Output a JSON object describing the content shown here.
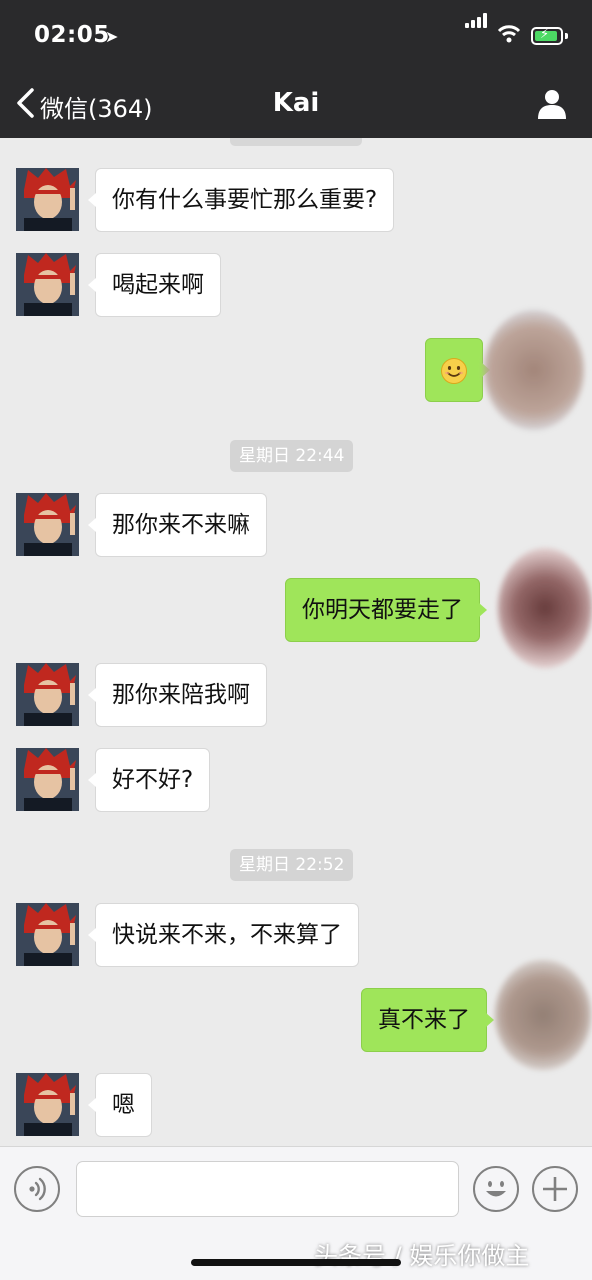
{
  "status_bar": {
    "time": "02:05"
  },
  "nav": {
    "back_label": "微信(364)",
    "title": "Kai"
  },
  "messages": [
    {
      "side": "left",
      "text": "你有什么事要忙那么重要?"
    },
    {
      "side": "left",
      "text": "喝起来啊"
    },
    {
      "side": "right",
      "text": "😊"
    },
    {
      "type": "timestamp",
      "text": "星期日 22:44"
    },
    {
      "side": "left",
      "text": "那你来不来嘛"
    },
    {
      "side": "right",
      "text": "你明天都要走了"
    },
    {
      "side": "left",
      "text": "那你来陪我啊"
    },
    {
      "side": "left",
      "text": "好不好?"
    },
    {
      "type": "timestamp",
      "text": "星期日 22:52"
    },
    {
      "side": "left",
      "text": "快说来不来，不来算了"
    },
    {
      "side": "right",
      "text": "真不来了"
    },
    {
      "side": "left",
      "text": "嗯"
    }
  ],
  "input_bar": {
    "text_value": ""
  },
  "watermark": {
    "text": "头条号 / 娱乐你做主"
  },
  "icons": {
    "location": "location-arrow-icon",
    "signal": "cellular-signal-icon",
    "wifi": "wifi-icon",
    "battery": "battery-charging-icon",
    "back": "chevron-left-icon",
    "profile": "person-icon",
    "voice": "voice-icon",
    "emoji": "emoji-icon",
    "more": "plus-icon"
  },
  "colors": {
    "header_bg": "#2a2a2c",
    "chat_bg": "#ebebeb",
    "sent_bubble": "#9fe55a",
    "received_bubble": "#ffffff"
  }
}
